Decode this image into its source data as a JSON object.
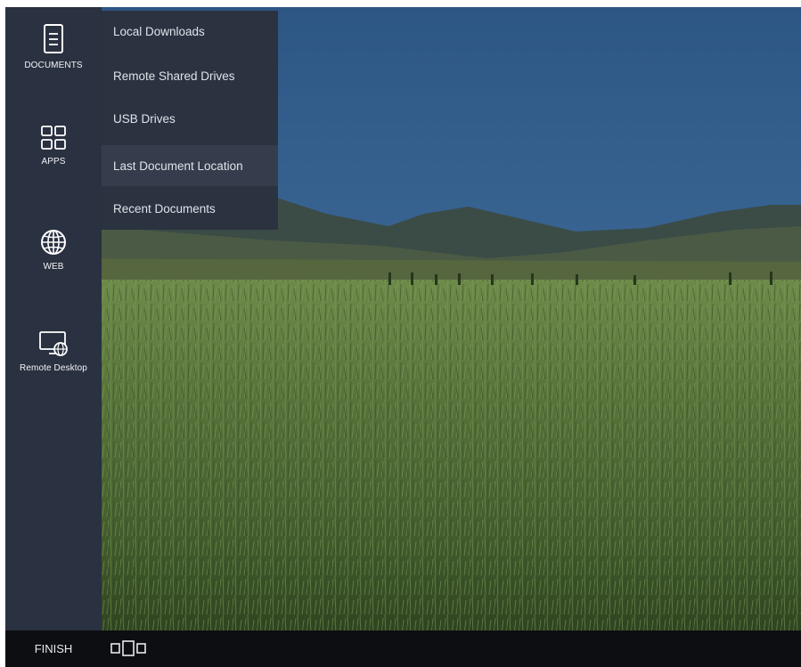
{
  "sidebar": {
    "items": [
      {
        "label": "DOCUMENTS",
        "icon": "document-icon"
      },
      {
        "label": "APPS",
        "icon": "apps-grid-icon"
      },
      {
        "label": "WEB",
        "icon": "globe-icon"
      },
      {
        "label": "Remote Desktop",
        "icon": "remote-desktop-icon"
      }
    ]
  },
  "submenu": {
    "items": [
      {
        "label": "Local Downloads",
        "active": false
      },
      {
        "label": "Remote Shared Drives",
        "active": false
      },
      {
        "label": "USB Drives",
        "active": false
      },
      {
        "label": "Last Document Location",
        "active": true
      },
      {
        "label": "Recent Documents",
        "active": false
      }
    ]
  },
  "taskbar": {
    "finish_label": "FINISH",
    "task_view_icon": "task-view-icon"
  },
  "colors": {
    "sidebar_bg": "#2a3140",
    "submenu_bg": "#2b3240",
    "submenu_active_bg": "#353d4c",
    "taskbar_bg": "#0c0e12",
    "sky": "#2f5b8c",
    "grass": "#5d7a3a"
  }
}
